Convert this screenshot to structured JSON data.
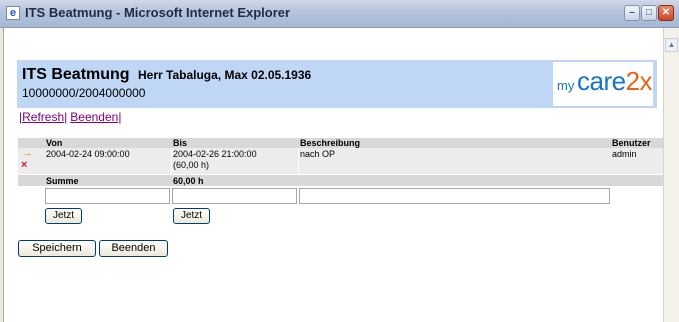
{
  "window": {
    "title": "ITS Beatmung - Microsoft Internet Explorer",
    "app_icon": "ie-icon",
    "controls": {
      "minimize": "–",
      "maximize": "□",
      "close": "✕"
    }
  },
  "header": {
    "title": "ITS Beatmung",
    "patient": "Herr Tabaluga, Max 02.05.1936",
    "case_number": "10000000/2004000000",
    "background_color": "#bfd7f5",
    "logo": {
      "my": "my",
      "care": "care",
      "suffix": "2x"
    }
  },
  "nav": {
    "sep_left": "|",
    "refresh": "Refresh",
    "sep_mid": "|",
    "beenden": "Beenden",
    "sep_right": "|"
  },
  "table": {
    "columns": [
      "Von",
      "Bis",
      "Beschreibung",
      "Benutzer"
    ],
    "rows": [
      {
        "von": "2004-02-24 09:00:00",
        "bis": "2004-02-26 21:00:00",
        "bis_hours": "(60,00 h)",
        "beschreibung": "nach OP",
        "benutzer": "admin",
        "row_icons": [
          "arrow-right-icon",
          "delete-icon"
        ]
      }
    ],
    "summary": {
      "label": "Summe",
      "value": "60,00 h"
    },
    "new_entry": {
      "von_value": "",
      "bis_value": "",
      "beschreibung_value": "",
      "jetzt_label": "Jetzt"
    }
  },
  "actions": {
    "save_label": "Speichern",
    "close_label": "Beenden"
  }
}
